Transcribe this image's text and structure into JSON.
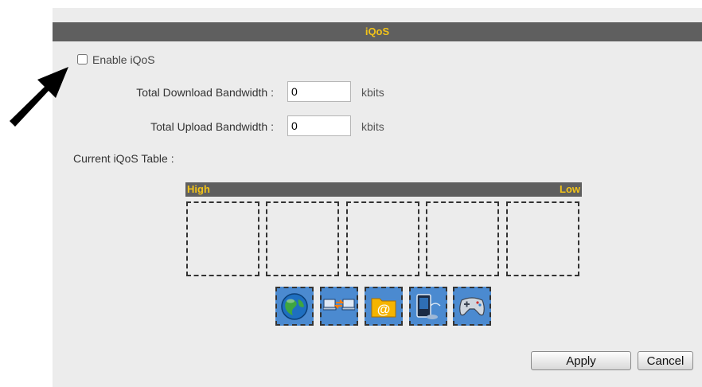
{
  "header": {
    "title": "iQoS"
  },
  "enable": {
    "label": "Enable iQoS",
    "checked": false
  },
  "download": {
    "label": "Total Download Bandwidth :",
    "value": "0",
    "unit": "kbits"
  },
  "upload": {
    "label": "Total Upload Bandwidth :",
    "value": "0",
    "unit": "kbits"
  },
  "table": {
    "title": "Current iQoS Table :",
    "high_label": "High",
    "low_label": "Low"
  },
  "services": [
    "globe-icon",
    "network-transfer-icon",
    "email-folder-icon",
    "media-player-icon",
    "gamepad-icon"
  ],
  "buttons": {
    "apply": "Apply",
    "cancel": "Cancel"
  },
  "colors": {
    "header_bg": "#5f5f5f",
    "header_text": "#f2c319",
    "panel_bg": "#ececec",
    "service_bg": "#4b8ad0"
  }
}
